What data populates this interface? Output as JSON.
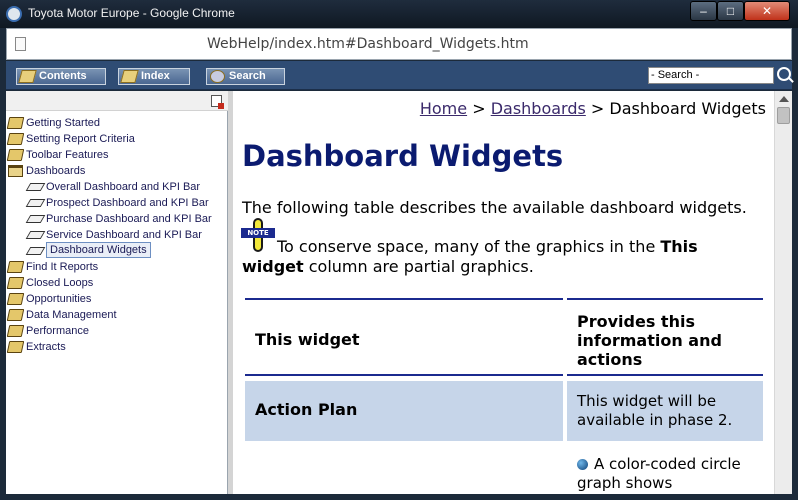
{
  "window": {
    "title": "Toyota Motor Europe - Google Chrome",
    "minimize": "–",
    "maximize": "□",
    "close": "✕"
  },
  "browser": {
    "url": "WebHelp/index.htm#Dashboard_Widgets.htm"
  },
  "toolbar": {
    "contents": "Contents",
    "index": "Index",
    "search": "Search",
    "search_value": "- Search -"
  },
  "toc": {
    "items": [
      {
        "label": "Getting Started",
        "icon": "book-icon"
      },
      {
        "label": "Setting Report Criteria",
        "icon": "book-icon"
      },
      {
        "label": "Toolbar Features",
        "icon": "book-icon"
      },
      {
        "label": "Dashboards",
        "icon": "book-open-icon"
      },
      {
        "label": "Overall Dashboard and KPI Bar",
        "icon": "page-icon"
      },
      {
        "label": "Prospect Dashboard and KPI Bar",
        "icon": "page-icon"
      },
      {
        "label": "Purchase Dashboard and KPI Bar",
        "icon": "page-icon"
      },
      {
        "label": "Service Dashboard and KPI Bar",
        "icon": "page-icon"
      },
      {
        "label": "Dashboard Widgets",
        "icon": "page-icon"
      },
      {
        "label": "Find It Reports",
        "icon": "book-icon"
      },
      {
        "label": "Closed Loops",
        "icon": "book-icon"
      },
      {
        "label": "Opportunities",
        "icon": "book-icon"
      },
      {
        "label": "Data Management",
        "icon": "book-icon"
      },
      {
        "label": "Performance",
        "icon": "book-icon"
      },
      {
        "label": "Extracts",
        "icon": "book-icon"
      }
    ]
  },
  "content": {
    "breadcrumb": {
      "home": "Home",
      "sep": ">",
      "section": "Dashboards",
      "current": "Dashboard Widgets"
    },
    "title": "Dashboard Widgets",
    "intro": "The following table describes the available dashboard widgets.",
    "note_tag": "NOTE",
    "note": {
      "before": "To conserve space, many of the graphics in the ",
      "bold": "This widget",
      "after": " column are partial graphics."
    },
    "table": {
      "headers": [
        "This widget",
        "Provides this information and actions"
      ],
      "rows": [
        {
          "widget": "Action Plan",
          "description": "This widget will be available in phase 2."
        },
        {
          "widget": "",
          "description": "A color-coded circle graph shows"
        }
      ]
    }
  }
}
